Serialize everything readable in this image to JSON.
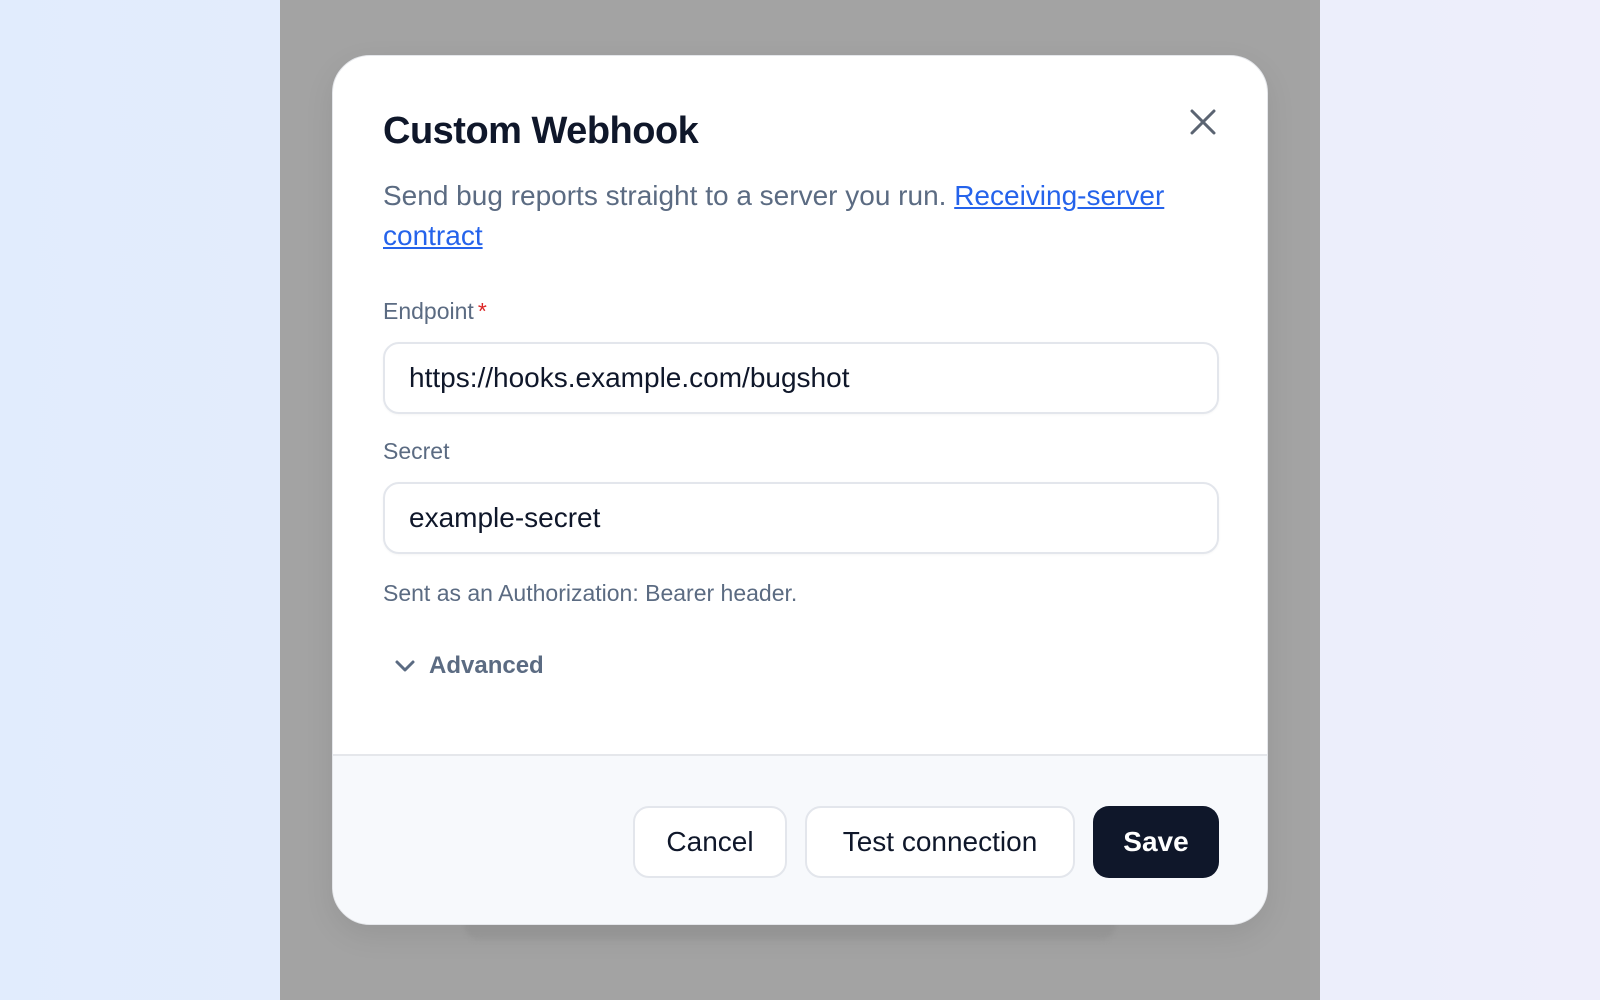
{
  "modal": {
    "title": "Custom Webhook",
    "description": "Send bug reports straight to a server you run.",
    "link_text": "Receiving-server contract",
    "close_icon": "close-icon"
  },
  "fields": {
    "endpoint": {
      "label": "Endpoint",
      "required_marker": "*",
      "value": "https://hooks.example.com/bugshot"
    },
    "secret": {
      "label": "Secret",
      "value": "example-secret",
      "helper": "Sent as an Authorization: Bearer header."
    }
  },
  "advanced": {
    "label": "Advanced",
    "icon": "chevron-down-icon"
  },
  "footer": {
    "cancel_label": "Cancel",
    "test_label": "Test connection",
    "save_label": "Save"
  },
  "colors": {
    "primary": "#0f172a",
    "link": "#2563eb",
    "required": "#dc2626",
    "muted_text": "#5b6b82"
  }
}
